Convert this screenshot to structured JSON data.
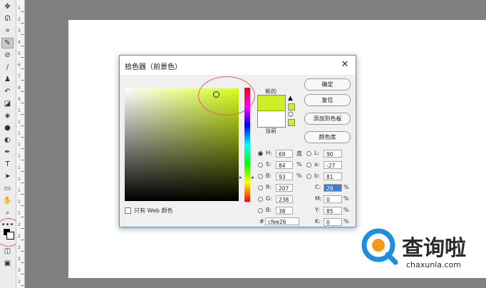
{
  "toolbar": {
    "tools": [
      "move-icon",
      "lasso-icon",
      "crop-icon",
      "eyedropper-icon",
      "healing-icon",
      "brush-icon",
      "stamp-icon",
      "history-brush-icon",
      "eraser-icon",
      "bucket-icon",
      "blur-icon",
      "dodge-icon",
      "pen-icon",
      "type-icon",
      "path-select-icon",
      "shape-icon",
      "hand-icon",
      "zoom-icon",
      "more-icon"
    ],
    "ruler_numbers": [
      "1",
      "2",
      "3",
      "4",
      "5",
      "6",
      "7",
      "8",
      "9",
      "1",
      "1",
      "1",
      "1",
      "1",
      "1",
      "1",
      "1",
      "1",
      "1",
      "2",
      "2",
      "2",
      "2",
      "2",
      "2"
    ]
  },
  "dialog": {
    "title": "拾色器（前景色）",
    "close_label": "✕",
    "new_label": "新的",
    "current_label": "当前",
    "ok_button": "确定",
    "reset_button": "复位",
    "add_swatch_button": "添加到色板",
    "color_library_button": "颜色库",
    "web_only_label": "只有 Web 颜色",
    "hsb": {
      "h_label": "H:",
      "h_value": "69",
      "h_unit": "度",
      "s_label": "S:",
      "s_value": "84",
      "s_unit": "%",
      "b_label": "B:",
      "b_value": "93",
      "b_unit": "%"
    },
    "rgb": {
      "r_label": "R:",
      "r_value": "207",
      "g_label": "G:",
      "g_value": "238",
      "b_label": "B:",
      "b_value": "38"
    },
    "lab": {
      "l_label": "L:",
      "l_value": "90",
      "a_label": "a:",
      "a_value": "-27",
      "b_label": "b:",
      "b_value": "81"
    },
    "cmyk": {
      "c_label": "C:",
      "c_value": "29",
      "c_unit": "%",
      "m_label": "M:",
      "m_value": "0",
      "m_unit": "%",
      "y_label": "Y:",
      "y_value": "85",
      "y_unit": "%",
      "k_label": "K:",
      "k_value": "0",
      "k_unit": "%"
    },
    "hex_label": "#",
    "hex_value": "cfee26"
  },
  "colors": {
    "new_color": "#cfee26",
    "current_color": "#ffffff",
    "highlight_circle": "#e8606a"
  },
  "watermark": {
    "text": "查询啦",
    "url": "chaxunla.com"
  }
}
